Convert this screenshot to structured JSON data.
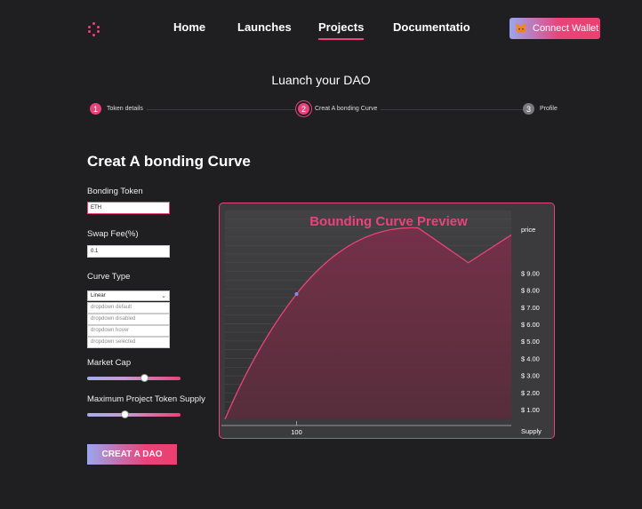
{
  "nav": {
    "items": [
      {
        "label": "Home",
        "active": false
      },
      {
        "label": "Launches",
        "active": false
      },
      {
        "label": "Projects",
        "active": true
      },
      {
        "label": "Documentatio",
        "active": false
      }
    ],
    "connect_wallet_label": "Connect Wallet"
  },
  "page_title": "Luanch your DAO",
  "steps": [
    {
      "number": "1",
      "label": "Token details",
      "state": "completed"
    },
    {
      "number": "2",
      "label": "Creat A bonding Curve",
      "state": "current"
    },
    {
      "number": "3",
      "label": "Profile",
      "state": "upcoming"
    }
  ],
  "form": {
    "title": "Creat A bonding Curve",
    "bonding_token_label": "Bonding Token",
    "bonding_token_value": "ETH",
    "swap_fee_label": "Swap Fee(%)",
    "swap_fee_value": "0.1",
    "curve_type_label": "Curve Type",
    "curve_type_selected": "Linear",
    "curve_type_options": [
      "dropdown default",
      "dropdown disabled",
      "dropdown hover",
      "dropdown selected"
    ],
    "market_cap_label": "Market Cap",
    "market_cap_level": 0.63,
    "max_supply_label": "Maximum Project Token Supply",
    "max_supply_level": 0.4,
    "create_button_label": "CREAT A DAO"
  },
  "chart_data": {
    "type": "area",
    "title": "Bounding Curve Preview",
    "ylabel": "price",
    "xlabel": "Supply",
    "x_ticks": [
      "100"
    ],
    "y_ticks": [
      "$ 1.00",
      "$ 2.00",
      "$ 3.00",
      "$ 4.00",
      "$ 5.00",
      "$ 6.00",
      "$ 7.00",
      "$ 8.00",
      "$ 9.00"
    ],
    "y_tick_values": [
      1,
      2,
      3,
      4,
      5,
      6,
      7,
      8,
      9
    ],
    "grid": true,
    "series": [
      {
        "values": [
          [
            0,
            0
          ],
          [
            100,
            7.2
          ],
          [
            270,
            11
          ],
          [
            340,
            9
          ],
          [
            400,
            10.6
          ]
        ]
      }
    ],
    "highlight_point": [
      100,
      7.2
    ],
    "colors": {
      "accent": "#e8447a",
      "point": "#7f8ef0"
    }
  },
  "colors": {
    "background": "#1f1f21",
    "accent": "#e8447a",
    "gradient_start": "#9aa6ef"
  }
}
